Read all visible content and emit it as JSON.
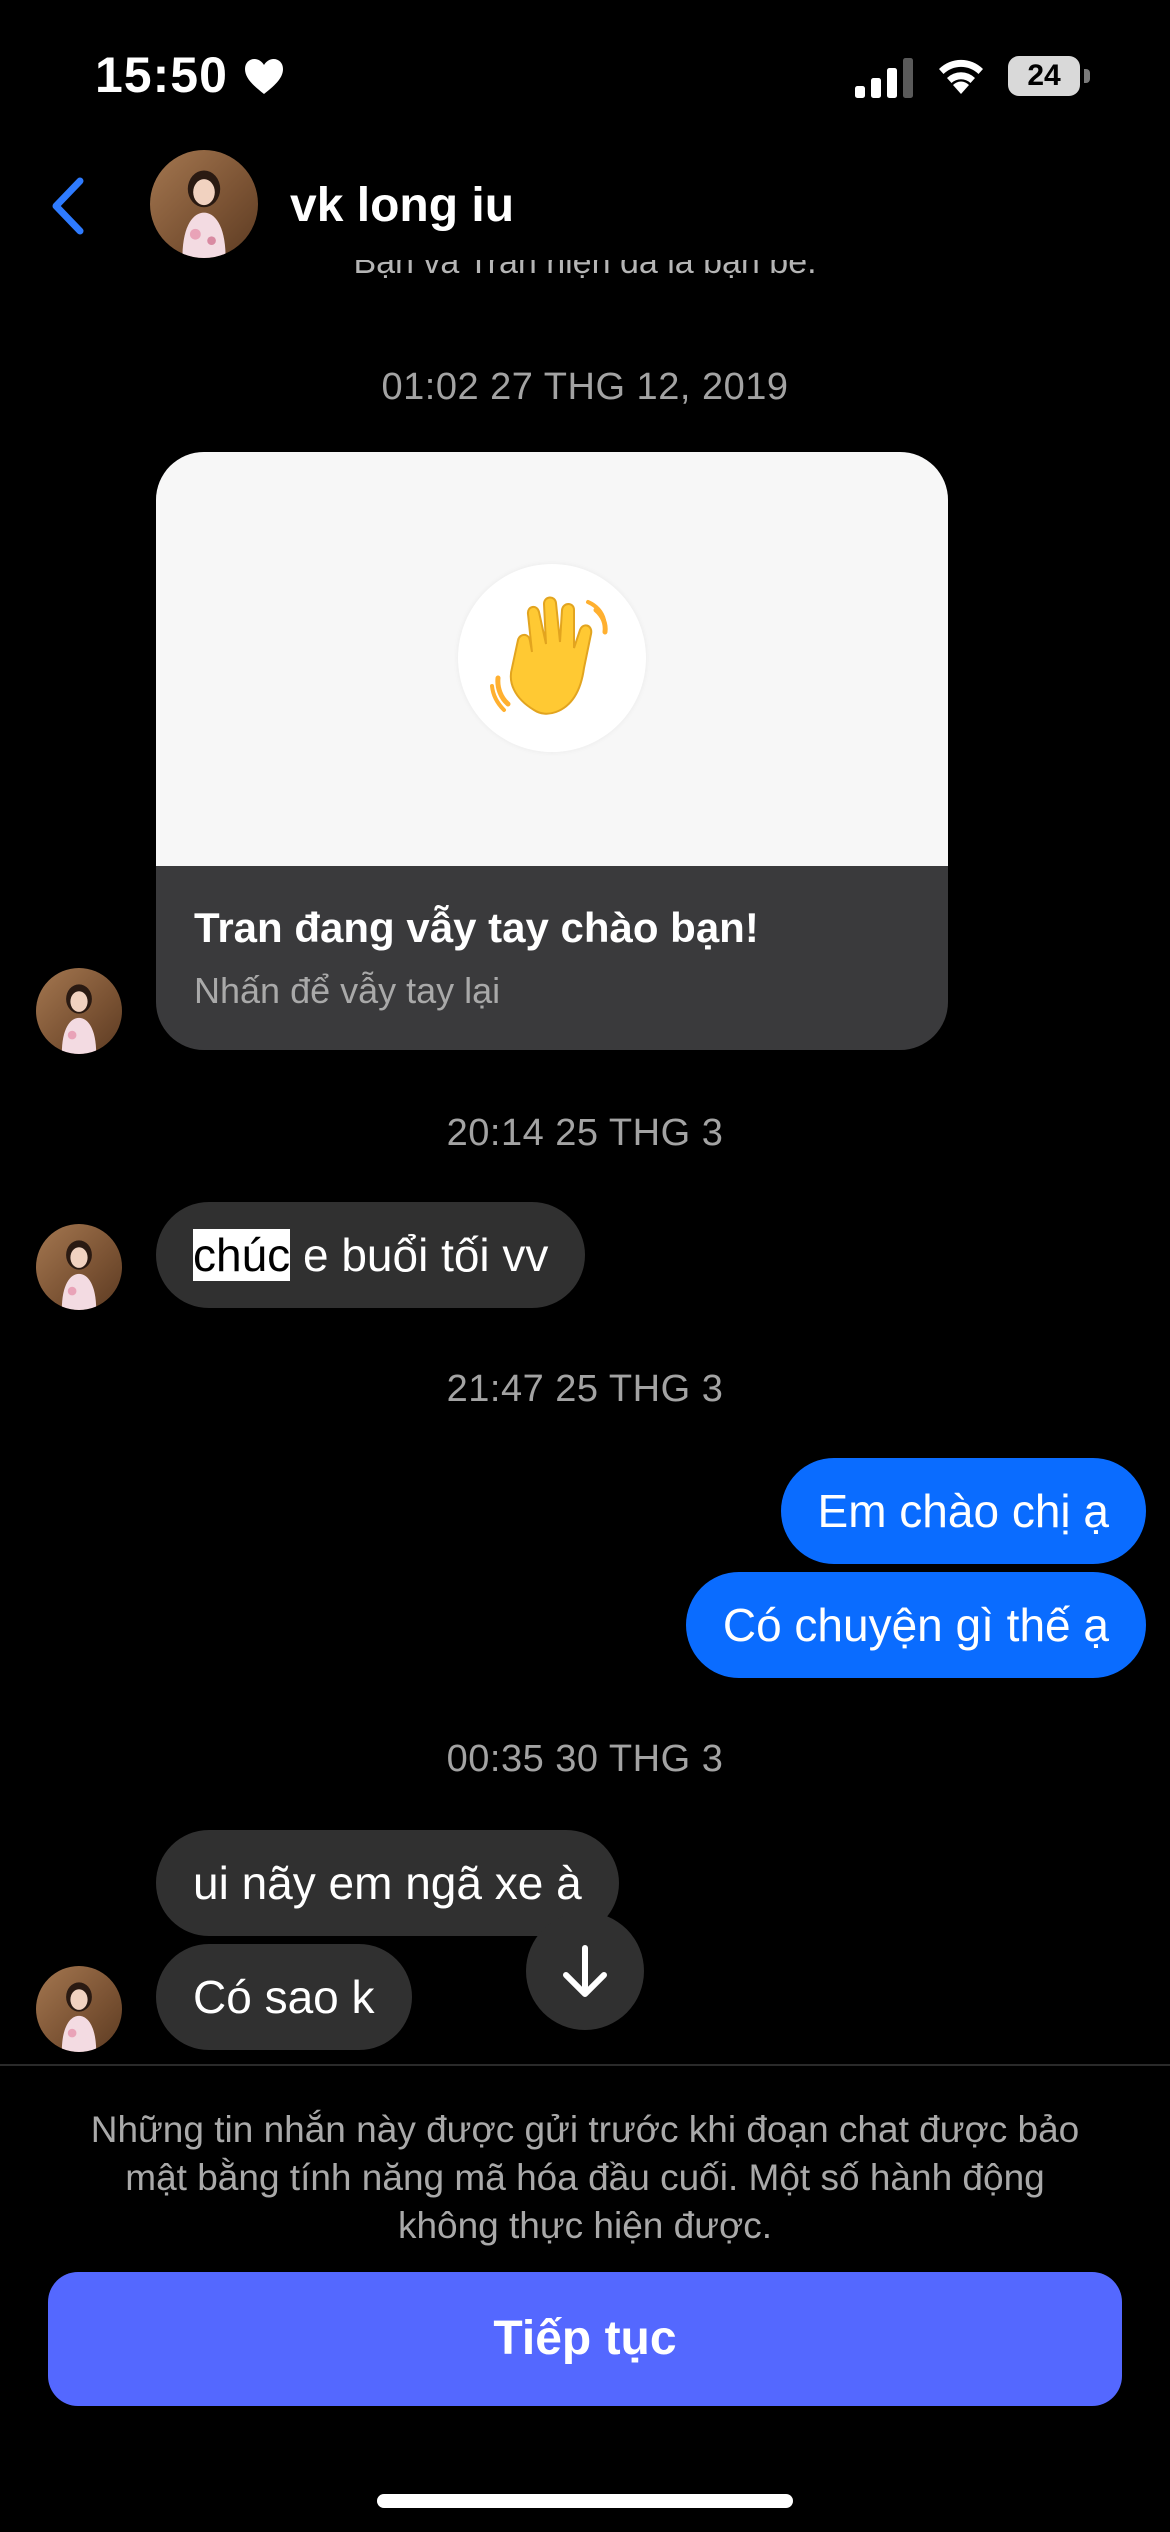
{
  "status_bar": {
    "time": "15:50",
    "battery": "24",
    "icons": [
      "heart-icon",
      "signal-icon",
      "wifi-icon",
      "battery-icon"
    ]
  },
  "header": {
    "contact_name": "vk long iu",
    "partial_notice": "Bạn và Tran hiện đã là bạn bè.",
    "icons": [
      "back-icon",
      "avatar"
    ]
  },
  "conversation": {
    "timestamps": [
      "01:02 27 THG 12, 2019",
      "20:14 25 THG 3",
      "21:47 25 THG 3",
      "00:35 30 THG 3"
    ],
    "wave_card": {
      "title": "Tran đang vẫy tay chào bạn!",
      "subtitle": "Nhấn để vẫy tay lại",
      "icon": "waving-hand-icon"
    },
    "messages": [
      {
        "sender": "them",
        "highlight": "chúc",
        "rest": " e buổi tối vv"
      },
      {
        "sender": "me",
        "text": "Em chào chị ạ"
      },
      {
        "sender": "me",
        "text": "Có chuyện gì thế ạ"
      },
      {
        "sender": "them",
        "text": "ui nãy em ngã xe à"
      },
      {
        "sender": "them",
        "text": "Có sao k"
      }
    ],
    "scroll_button_icon": "arrow-down-icon"
  },
  "footer": {
    "notice": "Những tin nhắn này được gửi trước khi đoạn chat được bảo mật bằng tính năng mã hóa đầu cuối. Một số hành động không thực hiện được.",
    "continue_label": "Tiếp tục"
  },
  "colors": {
    "background": "#000000",
    "incoming_bubble": "#303030",
    "outgoing_bubble": "#0a6cff",
    "continue_button": "#5468ff",
    "back_icon": "#2e7bff",
    "timestamp_text": "#a3a3a3"
  }
}
